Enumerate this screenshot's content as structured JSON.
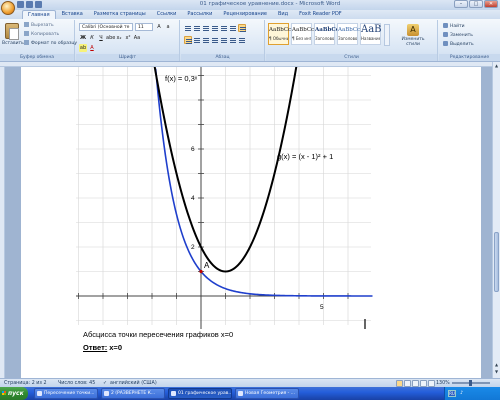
{
  "window": {
    "title": "01 графическое уравнение.docx - Microsoft Word",
    "minimize": "–",
    "maximize": "□",
    "close": "✕"
  },
  "ribbon": {
    "tabs": [
      "Главная",
      "Вставка",
      "Разметка страницы",
      "Ссылки",
      "Рассылки",
      "Рецензирование",
      "Вид",
      "Foxit Reader PDF"
    ],
    "clipboard": {
      "paste_label": "Вставить",
      "cut_label": "Вырезать",
      "copy_label": "Копировать",
      "format_painter_label": "Формат по образцу",
      "group_label": "Буфер обмена"
    },
    "font": {
      "font_name": "Calibri (Основной те",
      "font_size": "11",
      "group_label": "Шрифт"
    },
    "paragraph": {
      "group_label": "Абзац"
    },
    "styles": {
      "items": [
        {
          "sample": "AaBbCcDc",
          "name": "¶ Обычный"
        },
        {
          "sample": "AaBbCcDc",
          "name": "¶ Без инте..."
        },
        {
          "sample": "AaBbCc",
          "name": "Заголово..."
        },
        {
          "sample": "AaBbCc",
          "name": "Заголово..."
        },
        {
          "sample": "AaB",
          "name": "Название"
        }
      ],
      "change_styles_label": "Изменить стили",
      "group_label": "Стили"
    },
    "editing": {
      "find_label": "Найти",
      "replace_label": "Заменить",
      "select_label": "Выделить",
      "group_label": "Редактирование"
    }
  },
  "document": {
    "graph": {
      "f_label": "f(x) = 0,3ˣ",
      "g_label": "g(x) = (x - 1)² + 1",
      "point_label": "A",
      "y_tick_labels": [
        "2",
        "4",
        "6"
      ],
      "x_tick_labels": [
        "5"
      ]
    },
    "caption": "Абсцисса точки пересечения графиков х=0",
    "answer_label": "Ответ:",
    "answer_value": "х=0"
  },
  "statusbar": {
    "page": "Страница: 2 из 2",
    "words": "Число слов: 45",
    "language": "английский (США)",
    "zoom": "130%"
  },
  "taskbar": {
    "start_label": "пуск",
    "items": [
      {
        "label": "Пересечение точки...",
        "active": false
      },
      {
        "label": "2 (РАЗВЕРНЕТЕ К...",
        "active": false
      },
      {
        "label": "01 графическое урав...",
        "active": true
      },
      {
        "label": "Новая Геометрия - ...",
        "active": false
      }
    ],
    "clock": "",
    "lang": "RU"
  }
}
